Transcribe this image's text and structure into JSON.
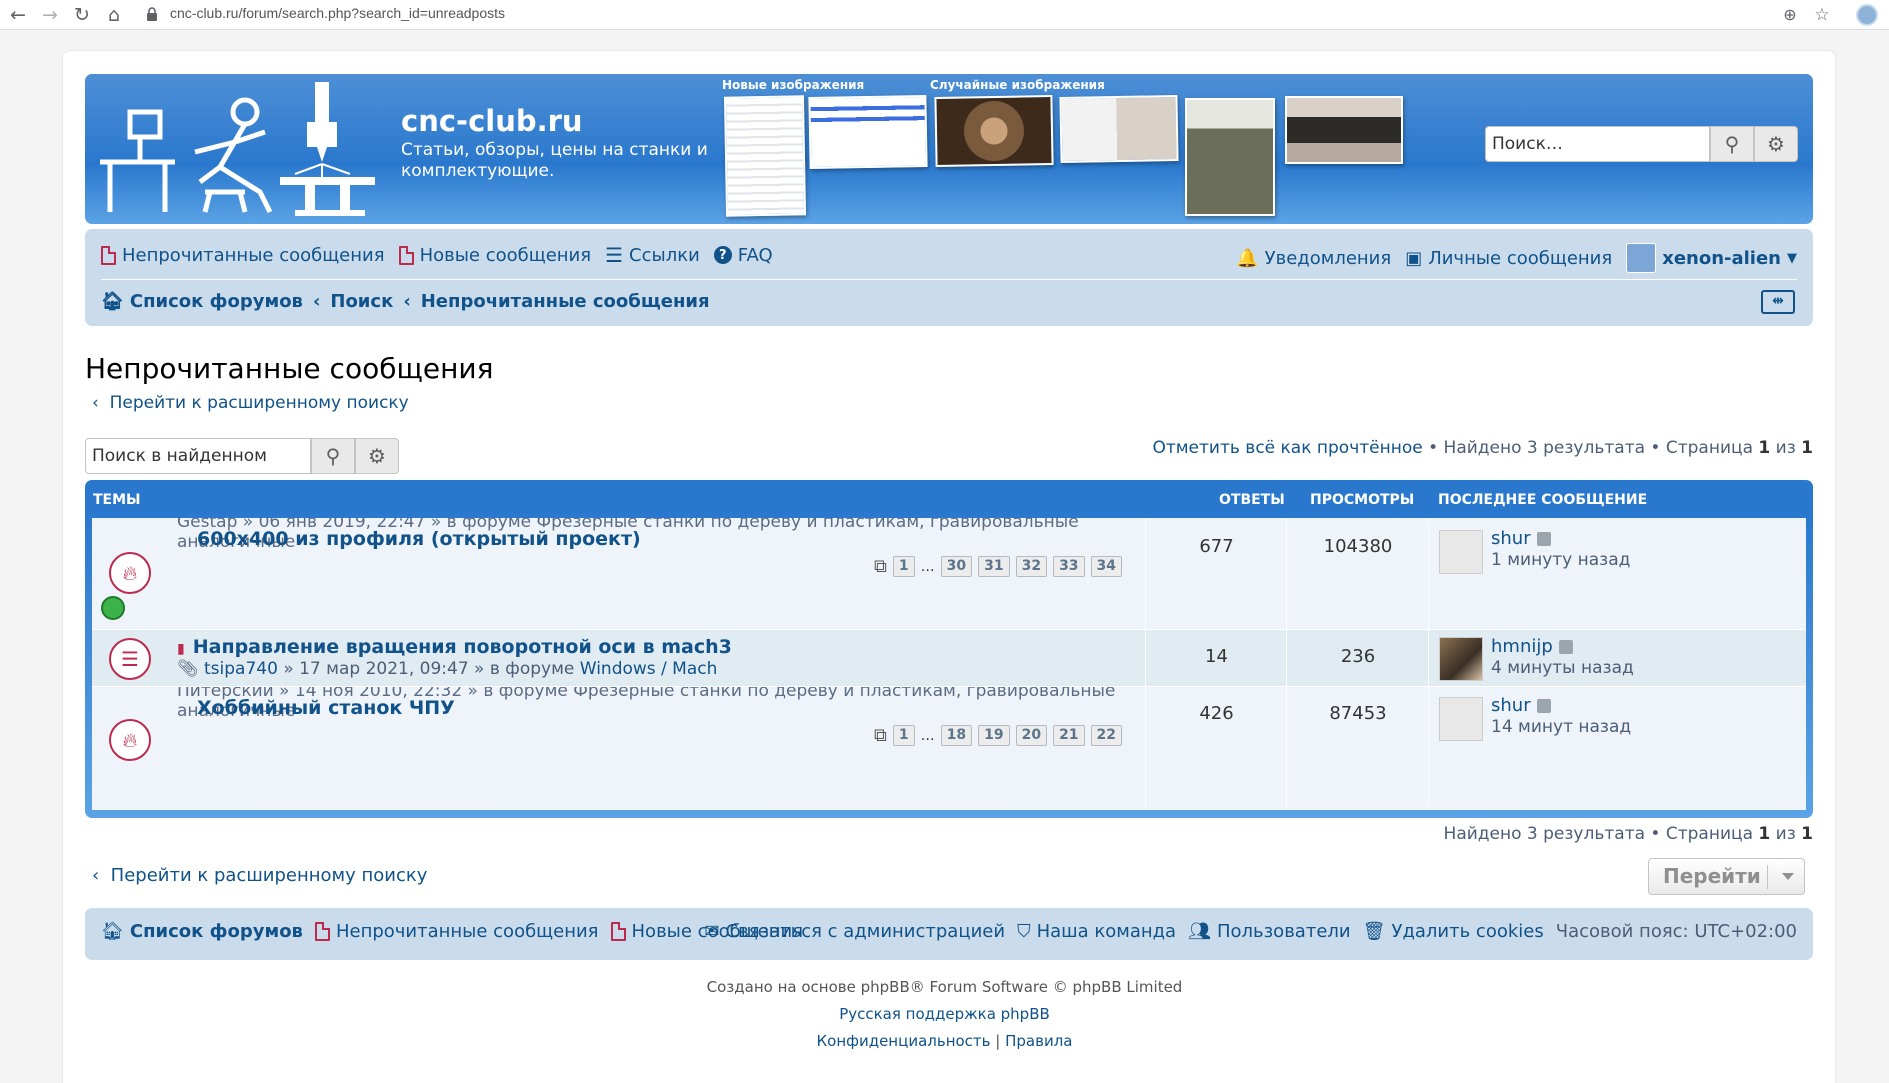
{
  "browser": {
    "url": "cnc-club.ru/forum/search.php?search_id=unreadposts"
  },
  "header": {
    "site_title": "cnc-club.ru",
    "site_desc": "Статьи, обзоры, цены на станки и комплектующие.",
    "new_images_caption": "Новые изображения",
    "random_images_caption": "Случайные изображения",
    "search_placeholder": "Поиск…"
  },
  "nav": {
    "unread": "Непрочитанные сообщения",
    "new_posts": "Новые сообщения",
    "links": "Ссылки",
    "faq": "FAQ",
    "notifications": "Уведомления",
    "pm": "Личные сообщения",
    "username": "xenon-alien",
    "crumbs": [
      "Список форумов",
      "Поиск",
      "Непрочитанные сообщения"
    ]
  },
  "page": {
    "title": "Непрочитанные сообщения",
    "adv_search": "Перейти к расширенному поиску",
    "search_in_results": "Поиск в найденном",
    "mark_read": "Отметить всё как прочтённое",
    "found": "Найдено 3 результата",
    "page_label": "Страница",
    "page_cur": "1",
    "page_of": "из",
    "page_total": "1"
  },
  "table": {
    "headers": {
      "topics": "ТЕМЫ",
      "replies": "ОТВЕТЫ",
      "views": "ПРОСМОТРЫ",
      "last": "ПОСЛЕДНЕЕ СООБЩЕНИЕ"
    },
    "rows": [
      {
        "title": "600х400 из профиля (открытый проект)",
        "ghost1": "Gestap » 06 янв 2019, 22:47 » в форуме Фрезерные станки по дереву и пластикам, гравировальные",
        "ghost2": "аналогичные",
        "pages": [
          "1",
          "…",
          "30",
          "31",
          "32",
          "33",
          "34"
        ],
        "replies": "677",
        "views": "104380",
        "last_user": "shur",
        "last_time": "1 минуту назад"
      },
      {
        "title": "Направление вращения поворотной оси в mach3",
        "author": "tsipa740",
        "date": "» 17 мар 2021, 09:47 » в форуме",
        "forum": "Windows / Mach",
        "replies": "14",
        "views": "236",
        "last_user": "hmnijp",
        "last_time": "4 минуты назад"
      },
      {
        "title": "Хоббийный станок ЧПУ",
        "ghost1": "Питерский » 14 ноя 2010, 22:32 » в форуме Фрезерные станки по дереву и пластикам, гравировальные",
        "ghost2": "аналогичные",
        "pages": [
          "1",
          "…",
          "18",
          "19",
          "20",
          "21",
          "22"
        ],
        "replies": "426",
        "views": "87453",
        "last_user": "shur",
        "last_time": "14 минут назад"
      }
    ]
  },
  "bottom": {
    "jump": "Перейти"
  },
  "footer": {
    "forums": "Список форумов",
    "unread": "Непрочитанные сообщения",
    "new_posts": "Новые сообщения",
    "contact": "Связаться с администрацией",
    "team": "Наша команда",
    "users": "Пользователи",
    "cookies": "Удалить cookies",
    "tz": "Часовой пояс:",
    "tz_val": "UTC+02:00",
    "copyright": "Создано на основе phpBB® Forum Software © phpBB Limited",
    "ru_support": "Русская поддержка phpBB",
    "privacy": "Конфиденциальность",
    "rules": "Правила"
  }
}
